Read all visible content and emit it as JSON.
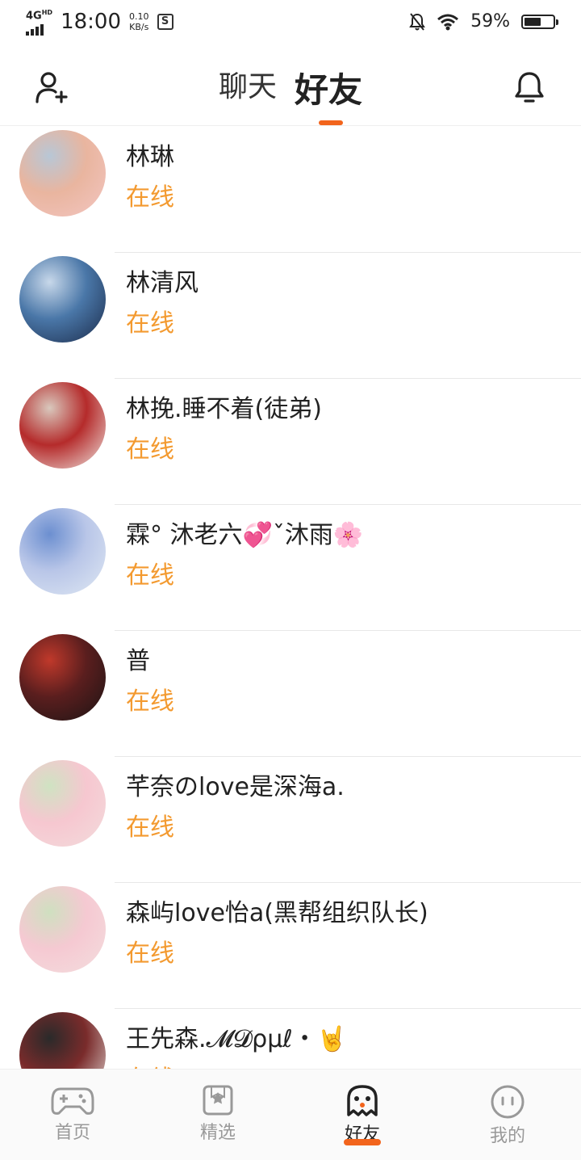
{
  "status_bar": {
    "network": "4G",
    "network_sup": "HD",
    "time": "18:00",
    "speed_value": "0.10",
    "speed_unit": "KB/s",
    "app_glyph": "S",
    "battery_pct": "59%",
    "battery_level": 0.59
  },
  "header": {
    "tabs": [
      "聊天",
      "好友"
    ],
    "active_tab": "好友",
    "left_icon": "add-friend-icon",
    "right_icon": "bell-icon"
  },
  "friends": [
    {
      "name": "林琳",
      "status": "在线",
      "colors": [
        "#f3c6c2",
        "#e9b59f",
        "#b8c7d6"
      ]
    },
    {
      "name": "林清风",
      "status": "在线",
      "colors": [
        "#1b2b4a",
        "#4a77a8",
        "#c8d8ea"
      ]
    },
    {
      "name": "林挽.睡不着(徒弟)",
      "status": "在线",
      "colors": [
        "#efe6e1",
        "#b52b2b",
        "#d9c8bd"
      ]
    },
    {
      "name": "霖°  沐老六💞ˇ沐雨🌸",
      "status": "在线",
      "colors": [
        "#dfe8f3",
        "#b9c6e8",
        "#6c8fd0"
      ]
    },
    {
      "name": "普",
      "status": "在线",
      "colors": [
        "#1b1414",
        "#5a1e1e",
        "#c0392b"
      ]
    },
    {
      "name": "芊奈のlove是深海a.",
      "status": "在线",
      "colors": [
        "#f3dcdc",
        "#f6c7d0",
        "#cfe3c2"
      ]
    },
    {
      "name": "森屿love怡a(黑帮组织队长)",
      "status": "在线",
      "colors": [
        "#f4dede",
        "#f5c9d2",
        "#cfe0c0"
      ]
    },
    {
      "name": "王先森.𝓜𝓓ρμℓ・🤘",
      "status": "在线",
      "colors": [
        "#e6e2de",
        "#7a2b2b",
        "#2a2a2a"
      ]
    }
  ],
  "tab_bar": {
    "items": [
      {
        "label": "首页",
        "icon": "gamepad-icon"
      },
      {
        "label": "精选",
        "icon": "bookmark-star-icon"
      },
      {
        "label": "好友",
        "icon": "ghost-icon"
      },
      {
        "label": "我的",
        "icon": "face-icon"
      }
    ],
    "active": "好友",
    "accent": "#f2641c"
  }
}
